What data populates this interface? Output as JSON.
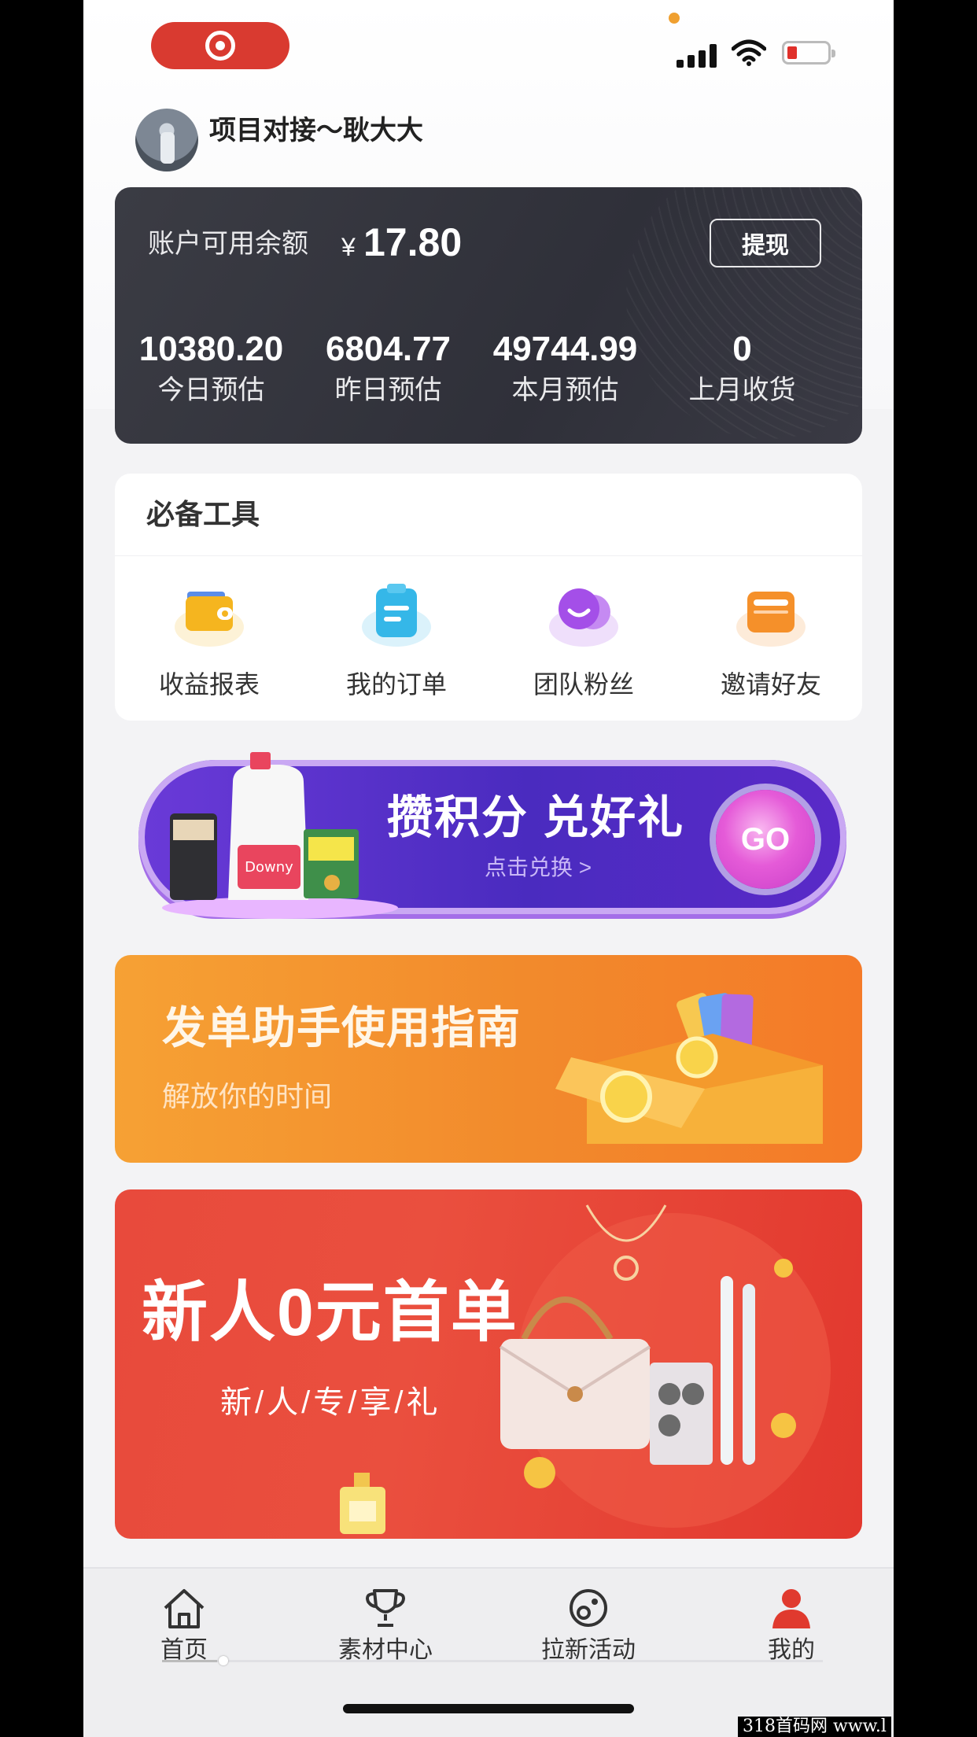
{
  "header": {
    "username": "项目对接～耿大大"
  },
  "balance": {
    "label": "账户可用余额",
    "currency": "¥",
    "value": "17.80",
    "withdraw_label": "提现",
    "stats": [
      {
        "value": "10380.20",
        "label": "今日预估"
      },
      {
        "value": "6804.77",
        "label": "昨日预估"
      },
      {
        "value": "49744.99",
        "label": "本月预估"
      },
      {
        "value": "0",
        "label": "上月收货"
      }
    ]
  },
  "tools": {
    "title": "必备工具",
    "items": [
      {
        "label": "收益报表",
        "icon": "wallet-icon",
        "color": "#f5b51f"
      },
      {
        "label": "我的订单",
        "icon": "order-icon",
        "color": "#35b7e8"
      },
      {
        "label": "团队粉丝",
        "icon": "team-icon",
        "color": "#a44fe8"
      },
      {
        "label": "邀请好友",
        "icon": "invite-icon",
        "color": "#f5902a"
      }
    ]
  },
  "banners": {
    "points_title": "攒积分 兑好礼",
    "points_sub": "点击兑换 >",
    "points_go": "GO",
    "points_brand": "Downy",
    "guide_title": "发单助手使用指南",
    "guide_sub": "解放你的时间",
    "new_title": "新人0元首单",
    "new_sub": "新/人/专/享/礼"
  },
  "tabbar": {
    "items": [
      {
        "label": "首页",
        "icon": "home-icon"
      },
      {
        "label": "素材中心",
        "icon": "trophy-icon"
      },
      {
        "label": "拉新活动",
        "icon": "activity-icon"
      },
      {
        "label": "我的",
        "icon": "profile-icon"
      }
    ],
    "active_color": "#e03a2e"
  },
  "watermark": "318首码网 www.l"
}
